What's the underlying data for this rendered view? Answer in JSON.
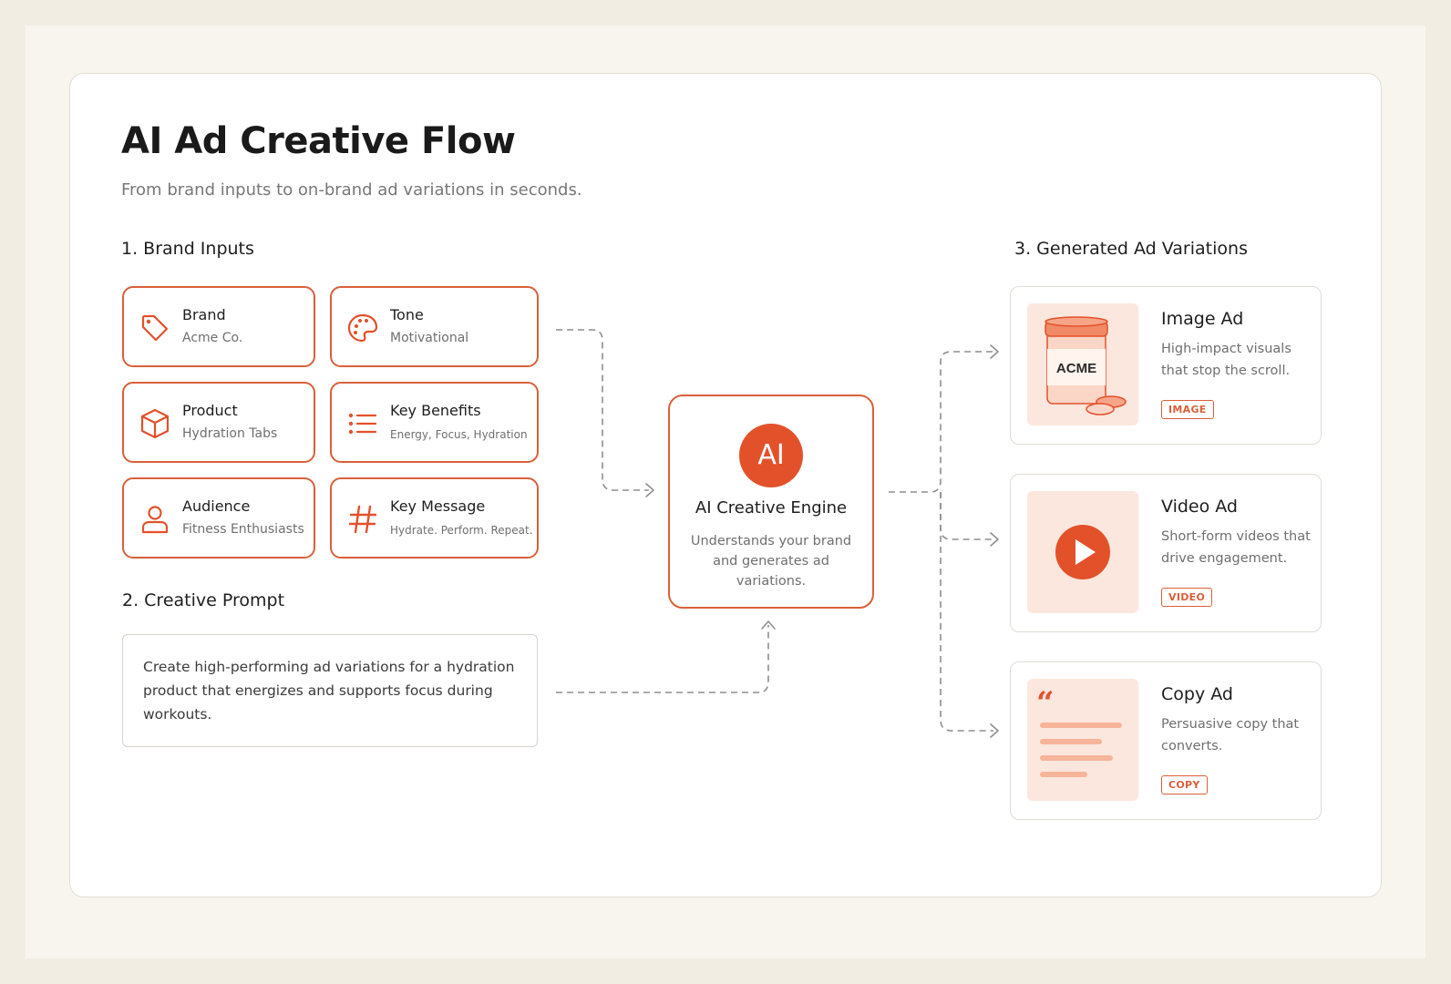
{
  "header": {
    "title": "AI Ad Creative Flow",
    "subtitle": "From brand inputs to on-brand ad variations in seconds."
  },
  "sections": {
    "inputs": "1.  Brand Inputs",
    "prompt": "2. Creative Prompt",
    "outputs": "3.  Generated Ad Variations"
  },
  "inputs": [
    {
      "label": "Brand",
      "value": "Acme Co.",
      "icon": "tag-icon"
    },
    {
      "label": "Tone",
      "value": "Motivational",
      "icon": "palette-icon"
    },
    {
      "label": "Product",
      "value": "Hydration Tabs",
      "icon": "box-icon"
    },
    {
      "label": "Key Benefits",
      "value": "Energy, Focus, Hydration",
      "icon": "list-icon"
    },
    {
      "label": "Audience",
      "value": "Fitness Enthusiasts",
      "icon": "person-icon"
    },
    {
      "label": "Key Message",
      "value": "Hydrate. Perform. Repeat.",
      "icon": "hash-icon"
    }
  ],
  "prompt": {
    "text": "Create high-performing ad variations for a hydration product that energizes and supports focus during workouts."
  },
  "engine": {
    "badge": "AI",
    "title": "AI Creative Engine",
    "description": "Understands your brand and generates ad variations."
  },
  "outputs": [
    {
      "title": "Image Ad",
      "description": "High-impact visuals that stop the scroll.",
      "tag": "IMAGE",
      "jar_label": "ACME"
    },
    {
      "title": "Video Ad",
      "description": "Short-form videos that drive engagement.",
      "tag": "VIDEO"
    },
    {
      "title": "Copy Ad",
      "description": "Persuasive copy that converts.",
      "tag": "COPY"
    }
  ],
  "colors": {
    "accent": "#e3512b",
    "border_accent": "#d9603a",
    "thumb_bg": "#fbe7de",
    "page_bg": "#f1ede3"
  }
}
